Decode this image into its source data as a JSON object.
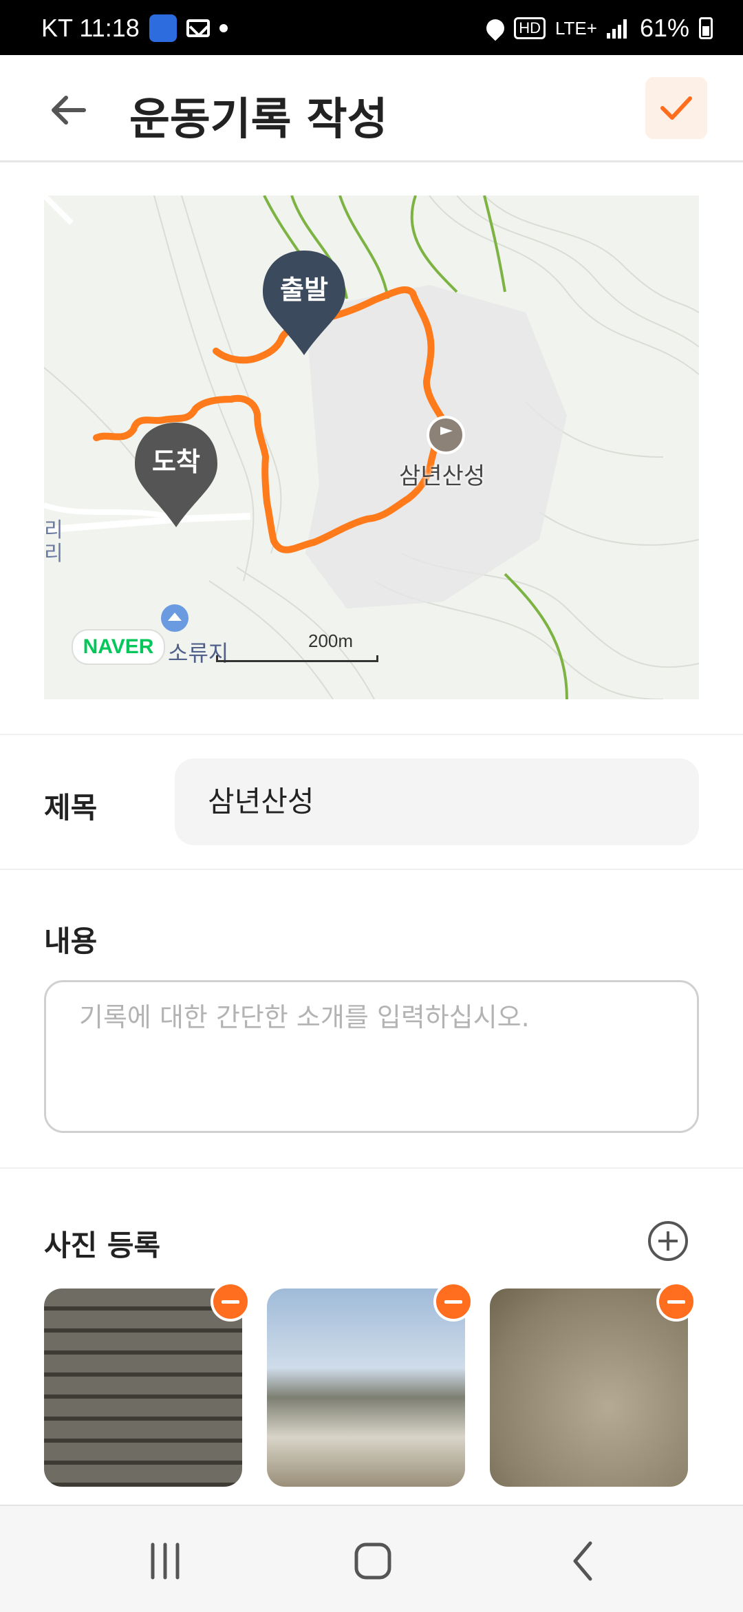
{
  "status_bar": {
    "carrier_time": "KT 11:18",
    "network": "LTE+",
    "battery": "61%"
  },
  "header": {
    "title": "운동기록 작성"
  },
  "map": {
    "start_label": "출발",
    "end_label": "도착",
    "poi_name": "삼년산성",
    "provider": "NAVER",
    "scale": "200m",
    "side_text": "리 리",
    "place_text": "소류지"
  },
  "form": {
    "title_label": "제목",
    "title_value": "삼년산성",
    "content_label": "내용",
    "content_placeholder": "기록에 대한 간단한 소개를 입력하십시오.",
    "photos_label": "사진 등록"
  },
  "colors": {
    "accent": "#ff6d1f",
    "route": "#ff7a1a",
    "pin_start": "#3b4a5c",
    "pin_end": "#555555"
  },
  "icons": [
    "back-arrow-icon",
    "check-icon",
    "plus-circle-icon",
    "minus-circle-icon",
    "location-icon",
    "signal-icon",
    "battery-icon",
    "mail-icon"
  ]
}
